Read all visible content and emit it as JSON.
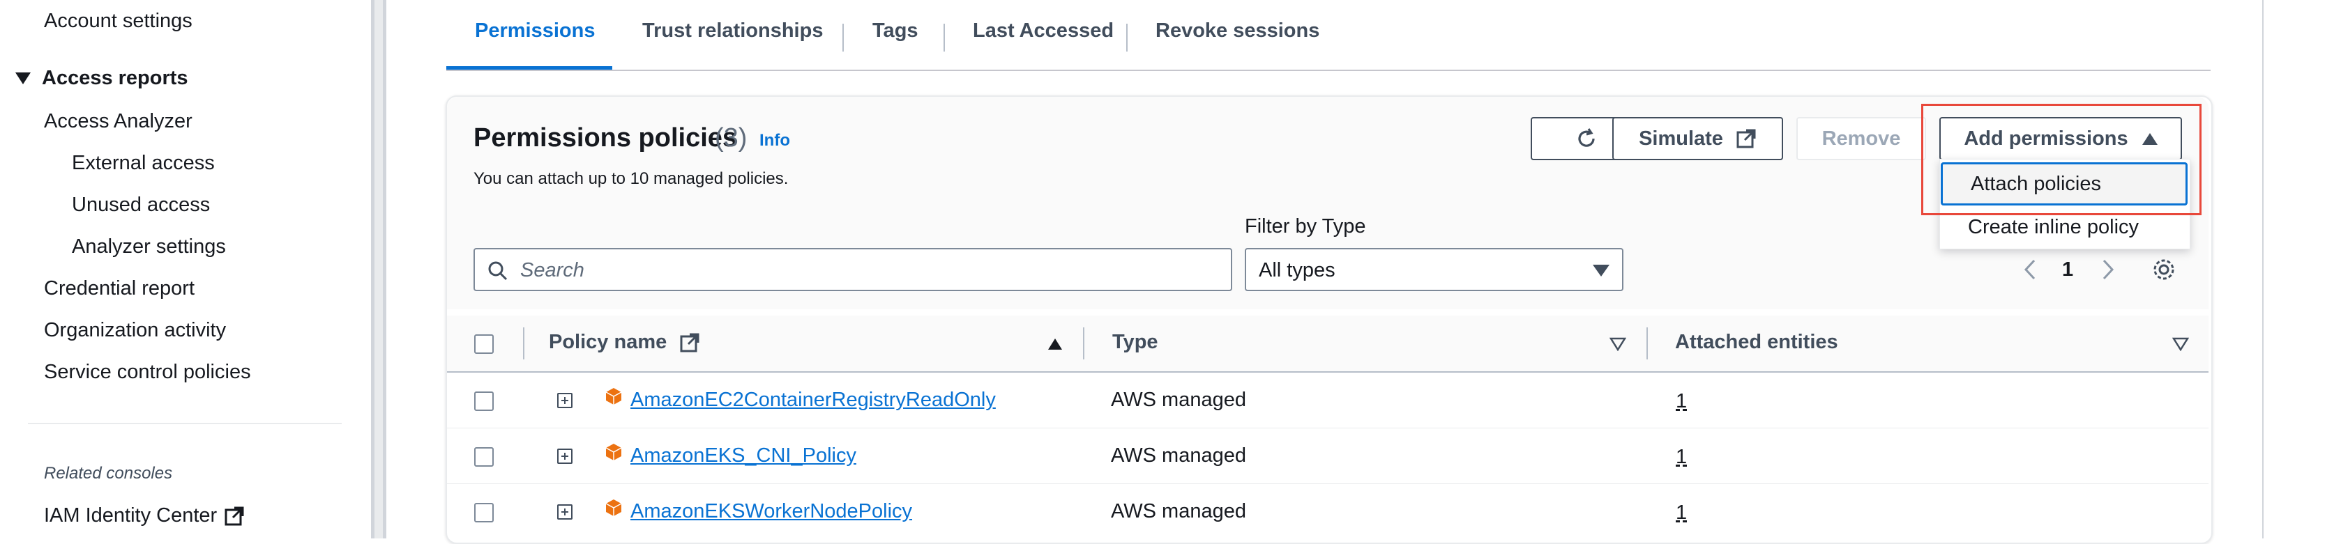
{
  "sidebar": {
    "account_settings": "Account settings",
    "access_reports": "Access reports",
    "access_analyzer": "Access Analyzer",
    "external_access": "External access",
    "unused_access": "Unused access",
    "analyzer_settings": "Analyzer settings",
    "credential_report": "Credential report",
    "organization_activity": "Organization activity",
    "service_control_policies": "Service control policies",
    "related_consoles": "Related consoles",
    "iam_identity_center": "IAM Identity Center"
  },
  "tabs": [
    "Permissions",
    "Trust relationships",
    "Tags",
    "Last Accessed",
    "Revoke sessions"
  ],
  "policies": {
    "title": "Permissions policies",
    "count": "(3)",
    "info": "Info",
    "description": "You can attach up to 10 managed policies.",
    "simulate": "Simulate",
    "remove": "Remove",
    "add_permissions": "Add permissions",
    "dropdown": [
      "Attach policies",
      "Create inline policy"
    ],
    "filter_label": "Filter by Type",
    "search_placeholder": "Search",
    "filter_value": "All types",
    "page": "1"
  },
  "table": {
    "headers": [
      "Policy name",
      "Type",
      "Attached entities"
    ],
    "rows": [
      {
        "name": "AmazonEC2ContainerRegistryReadOnly",
        "type": "AWS managed",
        "entities": "1"
      },
      {
        "name": "AmazonEKS_CNI_Policy",
        "type": "AWS managed",
        "entities": "1"
      },
      {
        "name": "AmazonEKSWorkerNodePolicy",
        "type": "AWS managed",
        "entities": "1"
      }
    ]
  },
  "colors": {
    "accent": "#0972d3",
    "highlight": "#e8483b",
    "policy_icon": "#ec7211"
  }
}
